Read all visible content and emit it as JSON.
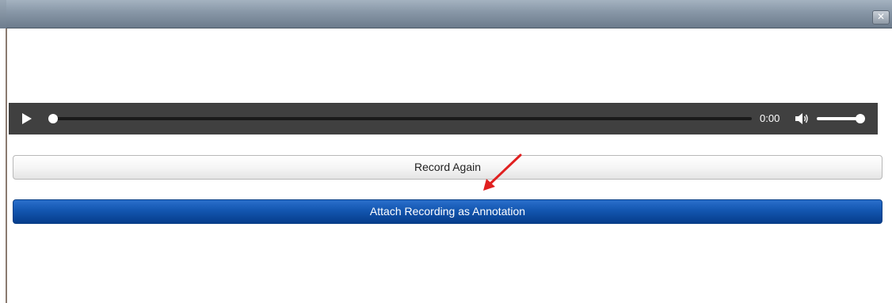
{
  "window": {
    "close_glyph": "✕",
    "close_icon": "close-icon"
  },
  "player": {
    "play_icon": "play-icon",
    "current_time": "0:00",
    "progress": 0,
    "volume_icon": "volume-icon",
    "volume_level": 1.0
  },
  "actions": {
    "record_again_label": "Record Again",
    "attach_label": "Attach Recording as Annotation"
  },
  "annotation": {
    "arrow_icon": "red-arrow-icon",
    "arrow_color": "#e02020"
  },
  "colors": {
    "titlebar": "#8796a6",
    "player_bg": "#404040",
    "primary_button": "#1356b0",
    "secondary_button": "#f4f4f4"
  }
}
